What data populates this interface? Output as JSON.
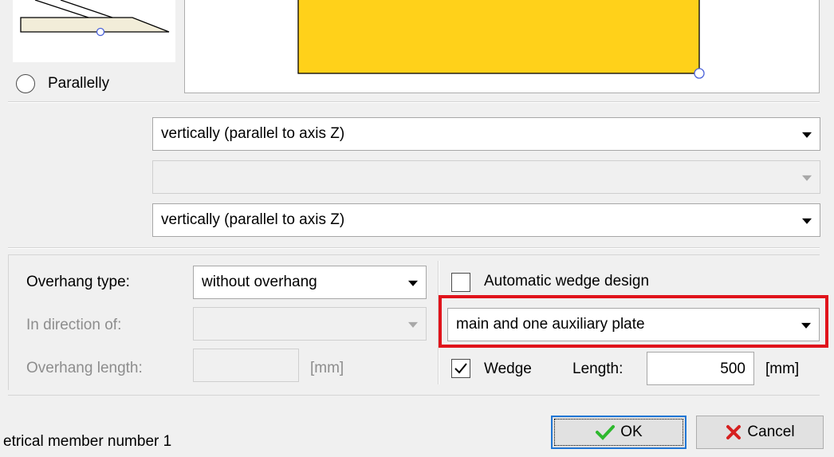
{
  "connection_side": {
    "parallelly_label": "Parallelly"
  },
  "direction_selects": [
    {
      "value": "vertically (parallel to axis Z)",
      "enabled": true
    },
    {
      "value": "",
      "enabled": false
    },
    {
      "value": "vertically (parallel to axis Z)",
      "enabled": true
    }
  ],
  "overhang": {
    "type_label": "Overhang type:",
    "type_value": "without overhang",
    "direction_label": "In direction of:",
    "direction_value": "",
    "length_label": "Overhang length:",
    "length_value": "",
    "length_unit": "[mm]"
  },
  "wedge": {
    "auto_design_label": "Automatic wedge design",
    "auto_design_checked": false,
    "plate_value": "main and one auxiliary plate",
    "wedge_label": "Wedge",
    "wedge_checked": true,
    "length_label": "Length:",
    "length_value": "500",
    "length_unit": "[mm]"
  },
  "footer": {
    "status_text": "etrical member number 1",
    "ok_label": "OK",
    "cancel_label": "Cancel"
  },
  "colors": {
    "plate_fill": "#ffd11a",
    "highlight_box": "#e0131b",
    "ok_check": "#2eb82e",
    "cancel_x": "#d62020"
  }
}
